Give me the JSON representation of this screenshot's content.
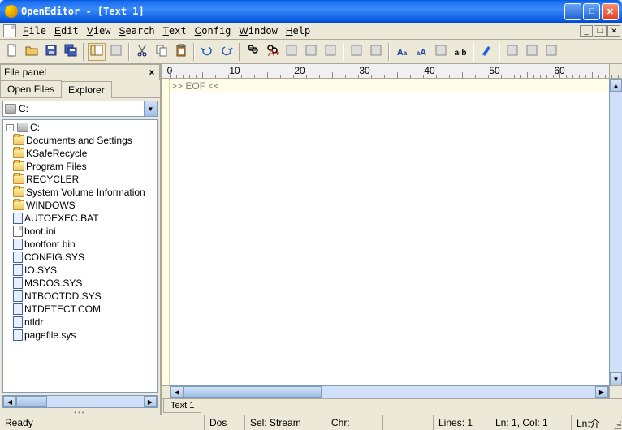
{
  "window": {
    "title": "OpenEditor - [Text 1]"
  },
  "menu": [
    "File",
    "Edit",
    "View",
    "Search",
    "Text",
    "Config",
    "Window",
    "Help"
  ],
  "toolbar_icons": [
    "new-icon",
    "open-icon",
    "save-icon",
    "save-all-icon",
    "toggle-panel-icon",
    "copy-path-icon",
    "cut-icon",
    "copy-icon",
    "paste-icon",
    "undo-icon",
    "redo-icon",
    "find-icon",
    "find-in-files-icon",
    "find-prev-icon",
    "find-next-icon",
    "bookmark-icon",
    "indent-left-icon",
    "indent-right-icon",
    "uppercase-icon",
    "lowercase-icon",
    "sort-icon",
    "word-icon",
    "highlight-icon",
    "tool1-icon",
    "tool2-icon",
    "tool3-icon"
  ],
  "file_panel": {
    "title": "File panel",
    "tabs": [
      "Open Files",
      "Explorer"
    ],
    "active_tab": 1,
    "drive": "C:",
    "tree": [
      {
        "type": "drive",
        "label": "C:",
        "expanded": true,
        "level": 0
      },
      {
        "type": "folder",
        "label": "Documents and Settings",
        "level": 1
      },
      {
        "type": "folder",
        "label": "KSafeRecycle",
        "level": 1
      },
      {
        "type": "folder",
        "label": "Program Files",
        "level": 1
      },
      {
        "type": "folder",
        "label": "RECYCLER",
        "level": 1
      },
      {
        "type": "folder",
        "label": "System Volume Information",
        "level": 1
      },
      {
        "type": "folder",
        "label": "WINDOWS",
        "level": 1
      },
      {
        "type": "sys",
        "label": "AUTOEXEC.BAT",
        "level": 1
      },
      {
        "type": "file",
        "label": "boot.ini",
        "level": 1
      },
      {
        "type": "sys",
        "label": "bootfont.bin",
        "level": 1
      },
      {
        "type": "sys",
        "label": "CONFIG.SYS",
        "level": 1
      },
      {
        "type": "sys",
        "label": "IO.SYS",
        "level": 1
      },
      {
        "type": "sys",
        "label": "MSDOS.SYS",
        "level": 1
      },
      {
        "type": "sys",
        "label": "NTBOOTDD.SYS",
        "level": 1
      },
      {
        "type": "sys",
        "label": "NTDETECT.COM",
        "level": 1
      },
      {
        "type": "sys",
        "label": "ntldr",
        "level": 1
      },
      {
        "type": "sys",
        "label": "pagefile.sys",
        "level": 1
      }
    ]
  },
  "ruler_ticks": [
    0,
    10,
    20,
    30,
    40,
    50,
    60
  ],
  "editor": {
    "eof_text": ">> EOF <<"
  },
  "doc_tabs": [
    "Text 1"
  ],
  "status": {
    "ready": "Ready",
    "encoding": "Dos",
    "sel": "Sel: Stream",
    "chr": "Chr:",
    "lines": "Lines: 1",
    "pos": "Ln: 1, Col: 1",
    "extra": "Ln:介"
  }
}
